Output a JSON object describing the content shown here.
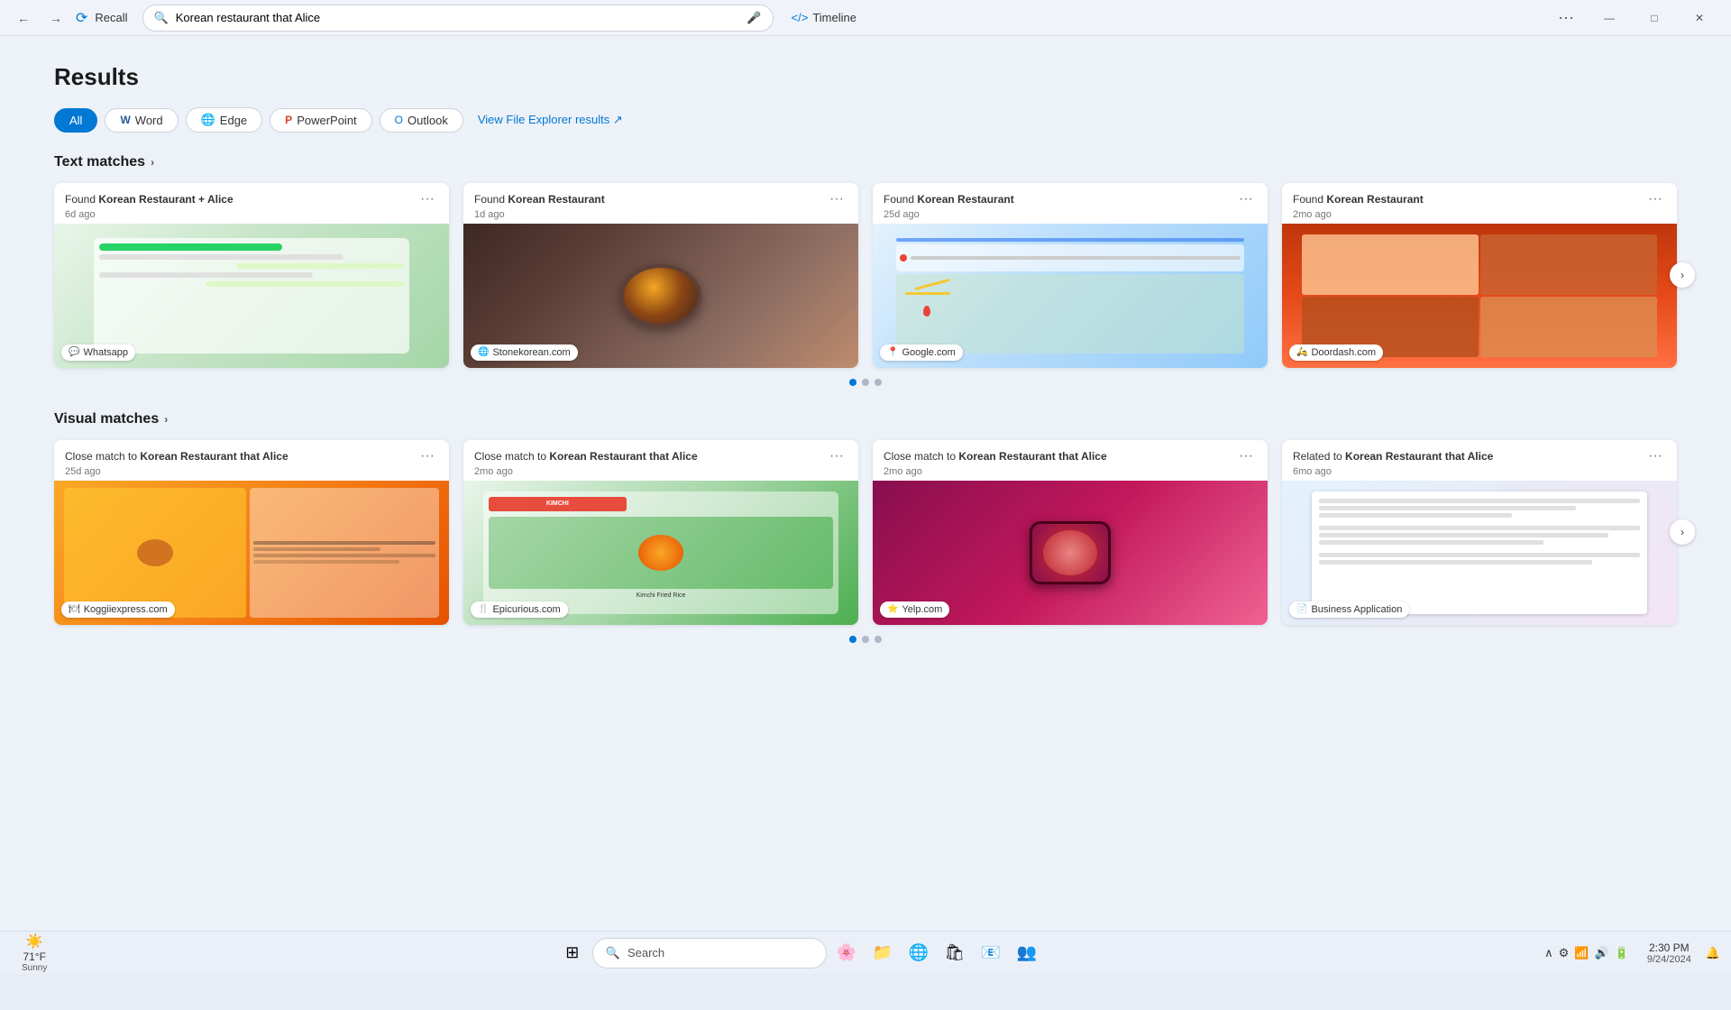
{
  "titlebar": {
    "app_name": "Recall",
    "back_label": "←",
    "forward_label": "→",
    "search_value": "Korean restaurant that Alice",
    "search_placeholder": "Korean restaurant that Alice",
    "mic_icon": "🎤",
    "timeline_label": "Timeline",
    "timeline_icon": "</>",
    "more_icon": "···",
    "minimize_label": "—",
    "maximize_label": "□",
    "close_label": "✕"
  },
  "page": {
    "title": "Results",
    "filter_tabs": [
      {
        "id": "all",
        "label": "All",
        "icon": "",
        "active": true
      },
      {
        "id": "word",
        "label": "Word",
        "icon": "W",
        "active": false
      },
      {
        "id": "edge",
        "label": "Edge",
        "icon": "e",
        "active": false
      },
      {
        "id": "powerpoint",
        "label": "PowerPoint",
        "icon": "P",
        "active": false
      },
      {
        "id": "outlook",
        "label": "Outlook",
        "icon": "O",
        "active": false
      }
    ],
    "view_file_link": "View File Explorer results ↗"
  },
  "text_matches": {
    "section_label": "Text matches",
    "chevron": "›",
    "cards": [
      {
        "id": "tm1",
        "title_prefix": "Found ",
        "title_bold": "Korean Restaurant + Alice",
        "time": "6d ago",
        "source": "Whatsapp",
        "source_icon": "💬",
        "image_class": "img-whatsapp"
      },
      {
        "id": "tm2",
        "title_prefix": "Found ",
        "title_bold": "Korean Restaurant",
        "time": "1d ago",
        "source": "Stonekorean.com",
        "source_icon": "🌐",
        "image_class": "img-stone"
      },
      {
        "id": "tm3",
        "title_prefix": "Found ",
        "title_bold": "Korean Restaurant",
        "time": "25d ago",
        "source": "Google.com",
        "source_icon": "📍",
        "image_class": "img-google"
      },
      {
        "id": "tm4",
        "title_prefix": "Found ",
        "title_bold": "Korean Restaurant",
        "time": "2mo ago",
        "source": "Doordash.com",
        "source_icon": "🛵",
        "image_class": "img-doordash"
      }
    ],
    "dots": [
      {
        "active": true
      },
      {
        "active": false
      },
      {
        "active": false
      }
    ]
  },
  "visual_matches": {
    "section_label": "Visual matches",
    "chevron": "›",
    "cards": [
      {
        "id": "vm1",
        "title_prefix": "Close match to ",
        "title_bold": "Korean Restaurant that Alice",
        "time": "25d ago",
        "source": "Koggiiexpress.com",
        "source_icon": "🍽",
        "image_class": "img-koggi"
      },
      {
        "id": "vm2",
        "title_prefix": "Close match to ",
        "title_bold": "Korean Restaurant that Alice",
        "time": "2mo ago",
        "source": "Epicurious.com",
        "source_icon": "🍴",
        "image_class": "img-epicurious"
      },
      {
        "id": "vm3",
        "title_prefix": "Close match to ",
        "title_bold": "Korean Restaurant that Alice",
        "time": "2mo ago",
        "source": "Yelp.com",
        "source_icon": "⭐",
        "image_class": "img-yelp"
      },
      {
        "id": "vm4",
        "title_prefix": "Related to ",
        "title_bold": "Korean Restaurant that Alice",
        "time": "6mo ago",
        "source": "Business Application",
        "source_icon": "📄",
        "image_class": "img-business"
      }
    ],
    "dots": [
      {
        "active": true
      },
      {
        "active": false
      },
      {
        "active": false
      }
    ]
  },
  "taskbar": {
    "weather_temp": "71°F",
    "weather_desc": "Sunny",
    "weather_icon": "☀️",
    "search_placeholder": "Search",
    "clock_time": "2:30 PM",
    "clock_date": "9/24/2024",
    "start_icon": "⊞",
    "search_icon": "🔍",
    "widgets_icon": "🌸",
    "file_icon": "📁",
    "edge_icon": "🌐",
    "store_icon": "🛍",
    "outlook_icon": "📧",
    "teams_icon": "👥"
  }
}
